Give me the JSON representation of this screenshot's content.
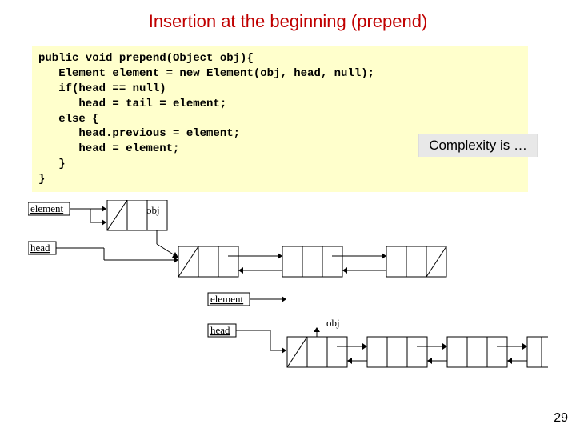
{
  "title": "Insertion at the beginning (prepend)",
  "code": "public void prepend(Object obj){\n   Element element = new Element(obj, head, null);\n   if(head == null)\n      head = tail = element;\n   else {\n      head.previous = element;\n      head = element;\n   }\n}",
  "complexity_note": "Complexity is …",
  "labels": {
    "element": "element",
    "head": "head",
    "obj": "obj"
  },
  "page_number": "29"
}
